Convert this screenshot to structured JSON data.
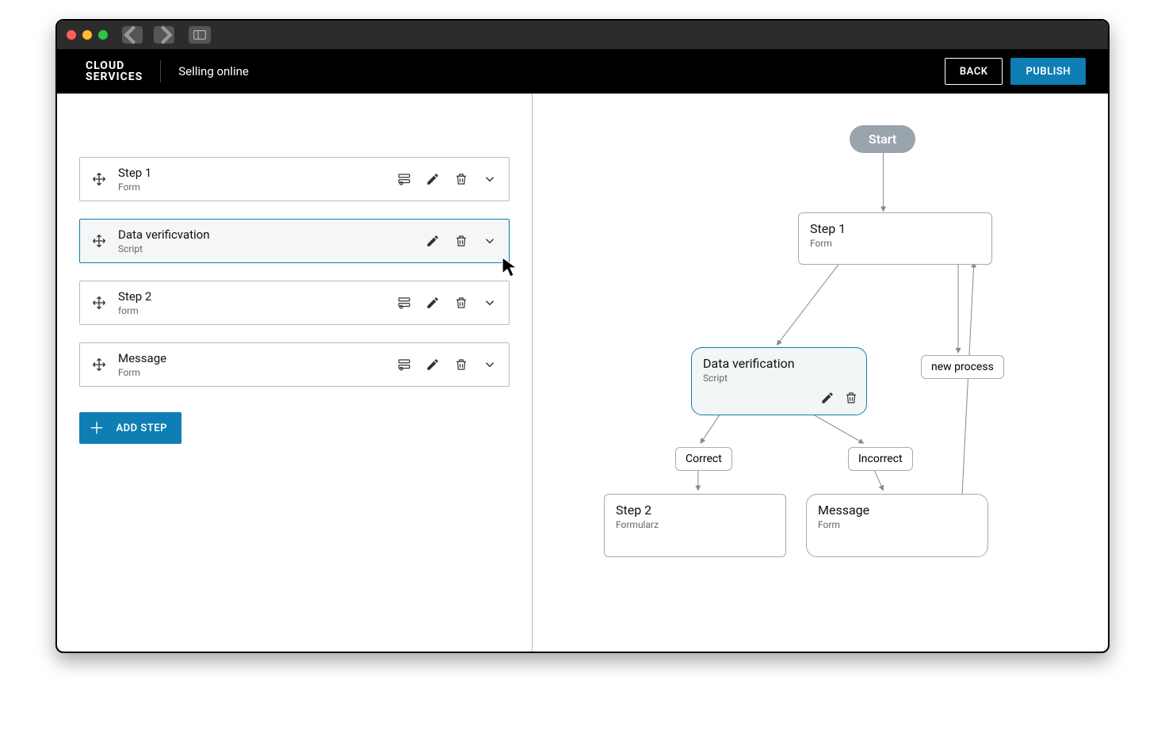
{
  "header": {
    "logo_line1": "CLOUD",
    "logo_line2": "SERVICES",
    "page_title": "Selling online",
    "back_label": "BACK",
    "publish_label": "PUBLISH"
  },
  "steps": [
    {
      "title": "Step 1",
      "subtitle": "Form",
      "selected": false,
      "show_config": true
    },
    {
      "title": "Data verificvation",
      "subtitle": "Script",
      "selected": true,
      "show_config": false
    },
    {
      "title": "Step 2",
      "subtitle": "form",
      "selected": false,
      "show_config": true
    },
    {
      "title": "Message",
      "subtitle": "Form",
      "selected": false,
      "show_config": true
    }
  ],
  "add_step_label": "ADD STEP",
  "flow": {
    "start_label": "Start",
    "nodes": {
      "step1": {
        "title": "Step 1",
        "subtitle": "Form"
      },
      "verify": {
        "title": "Data verification",
        "subtitle": "Script"
      },
      "newproc": {
        "title": "new process"
      },
      "correct": {
        "title": "Correct"
      },
      "incorrect": {
        "title": "Incorrect"
      },
      "step2": {
        "title": "Step 2",
        "subtitle": "Formularz"
      },
      "message": {
        "title": "Message",
        "subtitle": "Form"
      }
    }
  }
}
